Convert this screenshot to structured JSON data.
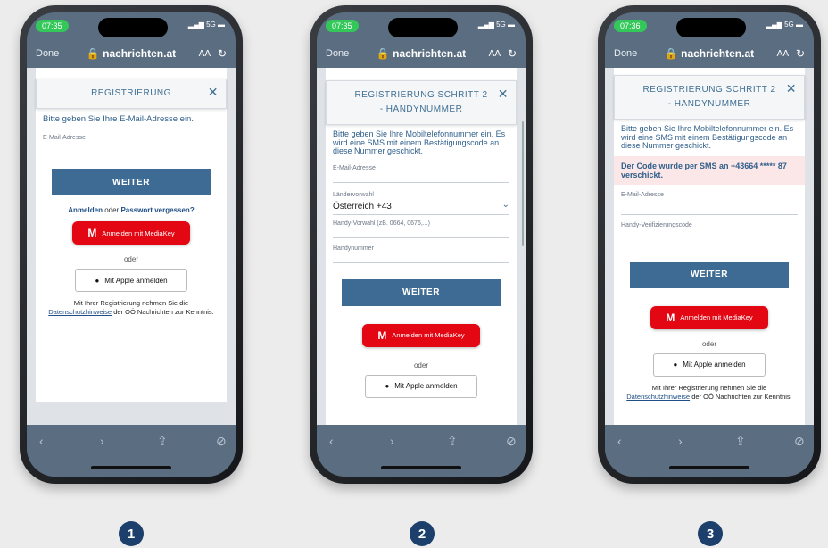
{
  "common": {
    "done": "Done",
    "url": "nachrichten.at",
    "aa": "AA",
    "reload": "↻",
    "weiter": "WEITER",
    "mediakey": "Anmelden mit MediaKey",
    "oder": "oder",
    "apple": "Mit Apple anmelden",
    "legal_pre": "Mit Ihrer Registrierung nehmen Sie die",
    "legal_link": "Datenschutzhinweise",
    "legal_post": "der OÖ Nachrichten zur Kenntnis.",
    "email_label": "E-Mail-Adresse",
    "signal": "5G"
  },
  "phone1": {
    "time": "07:35",
    "title": "REGISTRIERUNG",
    "intro": "Bitte geben Sie Ihre E-Mail-Adresse ein.",
    "link_login": "Anmelden",
    "link_or": "oder",
    "link_pw": "Passwort vergessen?"
  },
  "phone2": {
    "time": "07:35",
    "title": "REGISTRIERUNG SCHRITT 2 - HANDYNUMMER",
    "intro": "Bitte geben Sie Ihre Mobiltelefonnummer ein. Es wird eine SMS mit einem Bestätigungscode an diese Nummer geschickt.",
    "country_label": "Ländervorwahl",
    "country_value": "Österreich +43",
    "prefix_label": "Handy-Vorwahl (zB. 0664, 0676,...)",
    "number_label": "Handynummer"
  },
  "phone3": {
    "time": "07:36",
    "title": "REGISTRIERUNG SCHRITT 2 - HANDYNUMMER",
    "intro": "Bitte geben Sie Ihre Mobiltelefonnummer ein. Es wird eine SMS mit einem Bestätigungscode an diese Nummer geschickt.",
    "alert": "Der Code wurde per SMS an +43664 ***** 87 verschickt.",
    "code_label": "Handy-Verifizierungscode"
  },
  "steps": [
    "1",
    "2",
    "3"
  ]
}
